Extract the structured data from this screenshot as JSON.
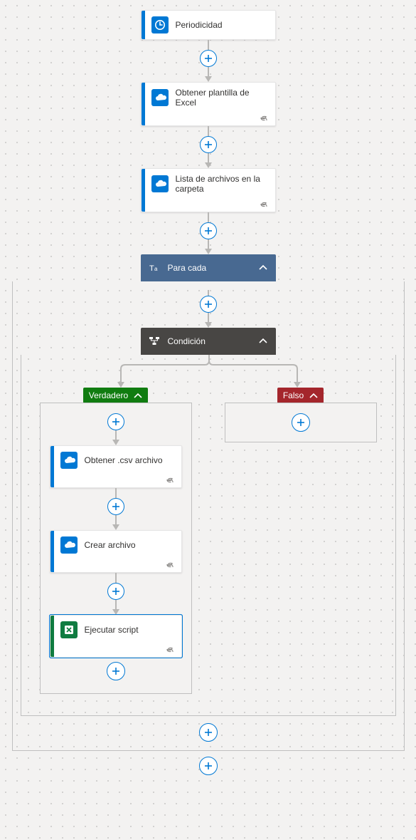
{
  "nodes": {
    "trigger": {
      "label": "Periodicidad"
    },
    "get_template": {
      "label": "Obtener plantilla de Excel"
    },
    "list_files": {
      "label": "Lista de archivos en la carpeta"
    },
    "foreach": {
      "label": "Para cada"
    },
    "condition": {
      "label": "Condición"
    },
    "branch_true": {
      "label": "Verdadero"
    },
    "branch_false": {
      "label": "Falso"
    },
    "get_csv": {
      "label": "Obtener .csv archivo"
    },
    "create_file": {
      "label": "Crear archivo"
    },
    "run_script": {
      "label": "Ejecutar script"
    }
  },
  "colors": {
    "onedrive_accent": "#0078d4",
    "excel_accent": "#107c41",
    "foreach_header": "#486991",
    "condition_header": "#484644",
    "true_badge": "#107c10",
    "false_badge": "#a4262c"
  },
  "icons": {
    "clock": "clock-icon",
    "cloud": "onedrive-icon",
    "xls": "excel-icon",
    "text": "text-icon",
    "branch": "branch-icon",
    "chevron": "chevron-up-icon",
    "link": "link-icon",
    "plus": "plus-icon"
  }
}
